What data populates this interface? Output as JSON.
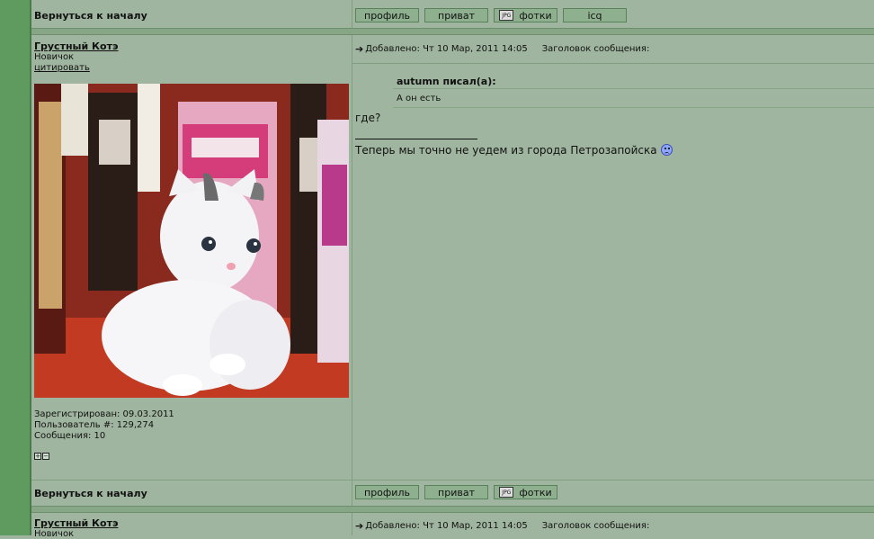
{
  "nav": {
    "back_to_top": "Вернуться к началу"
  },
  "buttons": {
    "profile": "профиль",
    "private": "приват",
    "photos": "фотки",
    "icq": "icq",
    "photo_icon_text": "JPG"
  },
  "post1": {
    "username": "Грустный Котэ",
    "rank": "Новичок",
    "quote_link": "цитировать",
    "added": "Добавлено: Чт 10 Мар, 2011 14:05",
    "subject_label": "Заголовок сообщения:",
    "quote_author": "autumn писал(а):",
    "quote_text": "А он есть",
    "message": "где?",
    "signature": "Теперь мы точно не уедем из города Петрозапойска",
    "registered": "Зарегистрирован: 09.03.2011",
    "user_no": "Пользователь #: 129,274",
    "posts": "Сообщения: 10",
    "avatar_icon": "kitten-photo"
  },
  "post2": {
    "username": "Грустный Котэ",
    "rank": "Новичок",
    "added": "Добавлено: Чт 10 Мар, 2011 14:05",
    "subject_label": "Заголовок сообщения:"
  }
}
